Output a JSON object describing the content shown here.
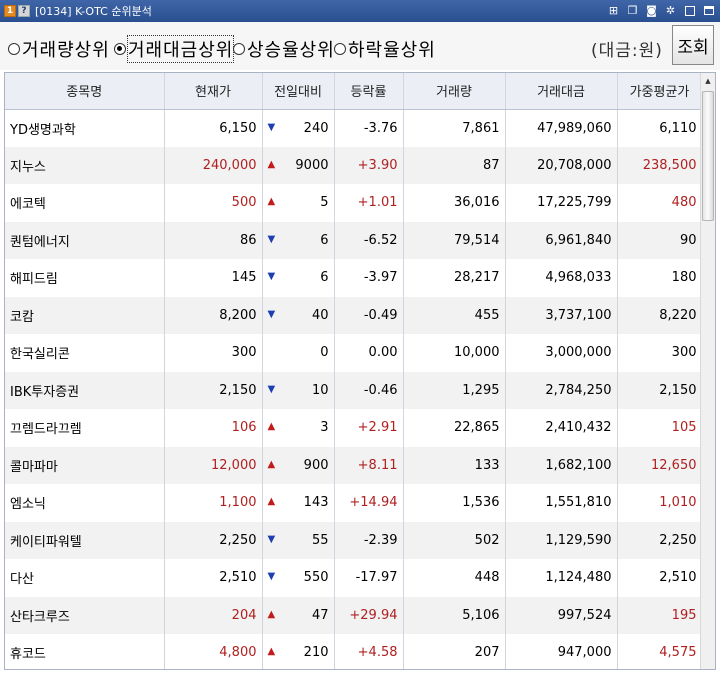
{
  "window": {
    "screen_no": "0134",
    "help_icon": "?",
    "title": "K-OTC 순위분석",
    "buttons": [
      "link-icon",
      "copy-icon",
      "camera-icon",
      "gear-icon",
      "minimize-icon",
      "maximize-icon"
    ]
  },
  "filters": {
    "options": [
      {
        "label": "거래량상위",
        "selected": false
      },
      {
        "label": "거래대금상위",
        "selected": true
      },
      {
        "label": "상승율상위",
        "selected": false
      },
      {
        "label": "하락율상위",
        "selected": false
      }
    ],
    "unit": "(대금:원)",
    "query_label": "조회"
  },
  "table": {
    "headers": [
      "종목명",
      "현재가",
      "전일대비",
      "등락률",
      "거래량",
      "거래대금",
      "가중평균가"
    ],
    "rows": [
      {
        "name": "YD생명과학",
        "price": "6,150",
        "dir": "down",
        "diff": "240",
        "rate": "-3.76",
        "volume": "7,861",
        "amount": "47,989,060",
        "avg": "6,110"
      },
      {
        "name": "지누스",
        "price": "240,000",
        "dir": "up",
        "diff": "9000",
        "rate": "+3.90",
        "volume": "87",
        "amount": "20,708,000",
        "avg": "238,500"
      },
      {
        "name": "에코텍",
        "price": "500",
        "dir": "up",
        "diff": "5",
        "rate": "+1.01",
        "volume": "36,016",
        "amount": "17,225,799",
        "avg": "480"
      },
      {
        "name": "퀀텀에너지",
        "price": "86",
        "dir": "down",
        "diff": "6",
        "rate": "-6.52",
        "volume": "79,514",
        "amount": "6,961,840",
        "avg": "90"
      },
      {
        "name": "해피드림",
        "price": "145",
        "dir": "down",
        "diff": "6",
        "rate": "-3.97",
        "volume": "28,217",
        "amount": "4,968,033",
        "avg": "180"
      },
      {
        "name": "코캄",
        "price": "8,200",
        "dir": "down",
        "diff": "40",
        "rate": "-0.49",
        "volume": "455",
        "amount": "3,737,100",
        "avg": "8,220"
      },
      {
        "name": "한국실리콘",
        "price": "300",
        "dir": "none",
        "diff": "0",
        "rate": "0.00",
        "volume": "10,000",
        "amount": "3,000,000",
        "avg": "300"
      },
      {
        "name": "IBK투자증권",
        "price": "2,150",
        "dir": "down",
        "diff": "10",
        "rate": "-0.46",
        "volume": "1,295",
        "amount": "2,784,250",
        "avg": "2,150"
      },
      {
        "name": "끄렘드라끄렘",
        "price": "106",
        "dir": "up",
        "diff": "3",
        "rate": "+2.91",
        "volume": "22,865",
        "amount": "2,410,432",
        "avg": "105"
      },
      {
        "name": "콜마파마",
        "price": "12,000",
        "dir": "up",
        "diff": "900",
        "rate": "+8.11",
        "volume": "133",
        "amount": "1,682,100",
        "avg": "12,650"
      },
      {
        "name": "엠소닉",
        "price": "1,100",
        "dir": "up",
        "diff": "143",
        "rate": "+14.94",
        "volume": "1,536",
        "amount": "1,551,810",
        "avg": "1,010"
      },
      {
        "name": "케이티파워텔",
        "price": "2,250",
        "dir": "down",
        "diff": "55",
        "rate": "-2.39",
        "volume": "502",
        "amount": "1,129,590",
        "avg": "2,250"
      },
      {
        "name": "다산",
        "price": "2,510",
        "dir": "down",
        "diff": "550",
        "rate": "-17.97",
        "volume": "448",
        "amount": "1,124,480",
        "avg": "2,510"
      },
      {
        "name": "산타크루즈",
        "price": "204",
        "dir": "up",
        "diff": "47",
        "rate": "+29.94",
        "volume": "5,106",
        "amount": "997,524",
        "avg": "195"
      },
      {
        "name": "휴코드",
        "price": "4,800",
        "dir": "up",
        "diff": "210",
        "rate": "+4.58",
        "volume": "207",
        "amount": "947,000",
        "avg": "4,575"
      }
    ]
  },
  "colors": {
    "up": "#c21b1b",
    "down": "#1d3fb0",
    "titlebar": "#2f58a0"
  }
}
